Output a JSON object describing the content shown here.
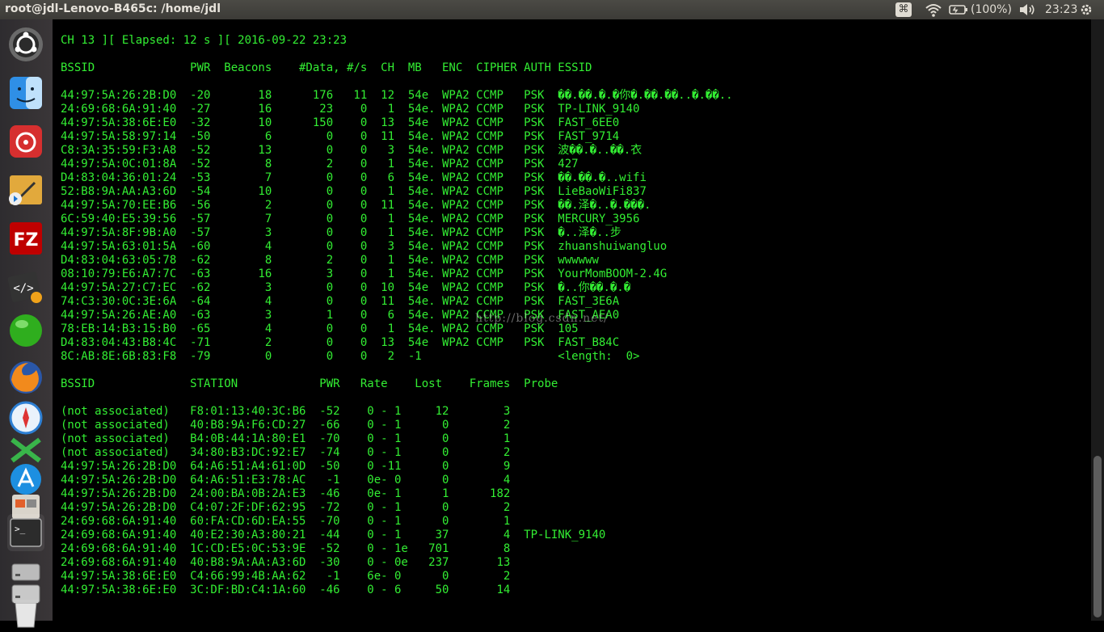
{
  "window": {
    "title": "root@jdl-Lenovo-B465c: /home/jdl"
  },
  "panel": {
    "keyboard_indicator": "⌘",
    "battery_percent": "(100%)",
    "clock": "23:23"
  },
  "terminal": {
    "lines": [
      "CH 13 ][ Elapsed: 12 s ][ 2016-09-22 23:23",
      "",
      "BSSID              PWR  Beacons    #Data, #/s  CH  MB   ENC  CIPHER AUTH ESSID",
      "",
      "44:97:5A:26:2B:D0  -20       18      176   11  12  54e  WPA2 CCMP   PSK  ��.��.�.�你�.��.��..�.��..",
      "24:69:68:6A:91:40  -27       16       23    0   1  54e. WPA2 CCMP   PSK  TP-LINK_9140",
      "44:97:5A:38:6E:E0  -32       10      150    0  13  54e  WPA2 CCMP   PSK  FAST_6EE0",
      "44:97:5A:58:97:14  -50        6        0    0  11  54e. WPA2 CCMP   PSK  FAST_9714",
      "C8:3A:35:59:F3:A8  -52       13        0    0   3  54e. WPA2 CCMP   PSK  波��.�..��.衣",
      "44:97:5A:0C:01:8A  -52        8        2    0   1  54e. WPA2 CCMP   PSK  427",
      "D4:83:04:36:01:24  -53        7        0    0   6  54e. WPA2 CCMP   PSK  ��.��.�..wifi",
      "52:B8:9A:AA:A3:6D  -54       10        0    0   1  54e. WPA2 CCMP   PSK  LieBaoWiFi837",
      "44:97:5A:70:EE:B6  -56        2        0    0  11  54e. WPA2 CCMP   PSK  ��.泽�..�.���.",
      "6C:59:40:E5:39:56  -57        7        0    0   1  54e. WPA2 CCMP   PSK  MERCURY_3956",
      "44:97:5A:8F:9B:A0  -57        3        0    0   1  54e. WPA2 CCMP   PSK  �..泽�..步",
      "44:97:5A:63:01:5A  -60        4        0    0   3  54e. WPA2 CCMP   PSK  zhuanshuiwangluo",
      "D4:83:04:63:05:78  -62        8        2    0   1  54e. WPA2 CCMP   PSK  wwwwww",
      "08:10:79:E6:A7:7C  -63       16        3    0   1  54e. WPA2 CCMP   PSK  YourMomBOOM-2.4G",
      "44:97:5A:27:C7:EC  -62        3        0    0  10  54e  WPA2 CCMP   PSK  �..你��.�.�",
      "74:C3:30:0C:3E:6A  -64        4        0    0  11  54e. WPA2 CCMP   PSK  FAST_3E6A",
      "44:97:5A:26:AE:A0  -63        3        1    0   6  54e. WPA2 CCMP   PSK  FAST_AEA0",
      "78:EB:14:B3:15:B0  -65        4        0    0   1  54e. WPA2 CCMP   PSK  105",
      "D4:83:04:43:B8:4C  -71        2        0    0  13  54e  WPA2 CCMP   PSK  FAST_B84C",
      "8C:AB:8E:6B:83:F8  -79        0        0    0   2  -1                    <length:  0>",
      "",
      "BSSID              STATION            PWR   Rate    Lost    Frames  Probe",
      "",
      "(not associated)   F8:01:13:40:3C:B6  -52    0 - 1     12        3",
      "(not associated)   40:B8:9A:F6:CD:27  -66    0 - 1      0        2",
      "(not associated)   B4:0B:44:1A:80:E1  -70    0 - 1      0        1",
      "(not associated)   34:80:B3:DC:92:E7  -74    0 - 1      0        2",
      "44:97:5A:26:2B:D0  64:A6:51:A4:61:0D  -50    0 -11      0        9",
      "44:97:5A:26:2B:D0  64:A6:51:E3:78:AC   -1    0e- 0      0        4",
      "44:97:5A:26:2B:D0  24:00:BA:0B:2A:E3  -46    0e- 1      1      182",
      "44:97:5A:26:2B:D0  C4:07:2F:DF:62:95  -72    0 - 1      0        2",
      "24:69:68:6A:91:40  60:FA:CD:6D:EA:55  -70    0 - 1      0        1",
      "24:69:68:6A:91:40  40:E2:30:A3:80:21  -44    0 - 1     37        4  TP-LINK_9140",
      "24:69:68:6A:91:40  1C:CD:E5:0C:53:9E  -52    0 - 1e   701        8",
      "24:69:68:6A:91:40  40:B8:9A:AA:A3:6D  -30    0 - 0e   237       13",
      "44:97:5A:38:6E:E0  C4:66:99:4B:AA:62   -1    6e- 0      0        2",
      "44:97:5A:38:6E:E0  3C:DF:BD:C4:1A:60  -46    0 - 6     50       14"
    ]
  },
  "watermark": "http://blog.csdn.net/",
  "launcher": {
    "items": [
      {
        "name": "ubuntu-dash-icon"
      },
      {
        "name": "finder-icon"
      },
      {
        "name": "netease-music-icon"
      },
      {
        "name": "install-tools-icon"
      },
      {
        "name": "filezilla-icon",
        "label": "FZ"
      },
      {
        "name": "code-editor-icon",
        "label": "</>"
      },
      {
        "name": "green-orb-icon"
      },
      {
        "name": "firefox-icon"
      },
      {
        "name": "safari-compass-icon"
      },
      {
        "name": "xmind-icon"
      },
      {
        "name": "app-store-icon"
      },
      {
        "name": "software-center-icon"
      },
      {
        "name": "terminal-icon",
        "label": ">_"
      },
      {
        "name": "drive-icon"
      },
      {
        "name": "disk-icon"
      },
      {
        "name": "trash-icon"
      }
    ]
  },
  "colors": {
    "terminal_fg": "#33ee33",
    "terminal_bg": "#000000",
    "panel_bg": "#3c3b37"
  }
}
